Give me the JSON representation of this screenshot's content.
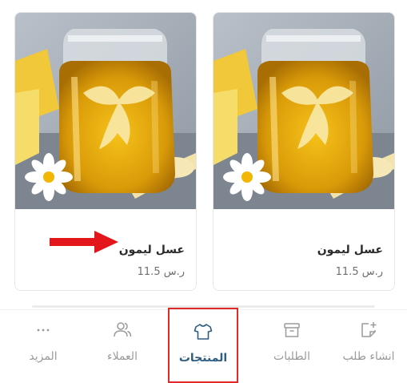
{
  "products": [
    {
      "name": "عسل ليمون",
      "price": "11.5 ر.س"
    },
    {
      "name": "عسل ليمون",
      "price": "11.5 ر.س"
    }
  ],
  "bottom_nav": {
    "items": [
      {
        "id": "more",
        "label": "المزيد",
        "icon": "more-dots-icon"
      },
      {
        "id": "clients",
        "label": "العملاء",
        "icon": "users-icon"
      },
      {
        "id": "products",
        "label": "المنتجات",
        "icon": "tshirt-icon",
        "active": true
      },
      {
        "id": "orders",
        "label": "الطلبات",
        "icon": "archive-box-icon"
      },
      {
        "id": "create_order",
        "label": "انشاء طلب",
        "icon": "add-note-icon"
      }
    ]
  },
  "colors": {
    "active": "#2d5d83",
    "inactive": "#9a9a9a",
    "highlight": "#e02a2a"
  }
}
